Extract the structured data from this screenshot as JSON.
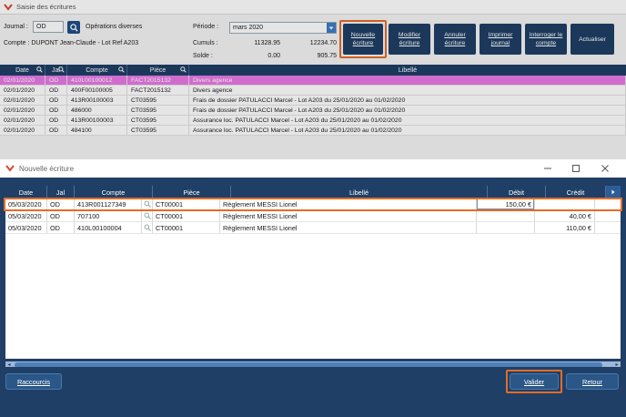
{
  "background_window": {
    "title": "Saisie des écritures",
    "journal_label": "Journal :",
    "journal_value": "OD",
    "journal_desc": "Opérations diverses",
    "periode_label": "Période :",
    "periode_value": "mars 2020",
    "compte_label": "Compte : DUPONT Jean-Claude - Lot Ref A203",
    "cumuls_label": "Cumuls :",
    "cumuls_debit": "11328.95",
    "cumuls_credit": "12234.70",
    "solde_label": "Solde :",
    "solde_debit": "0.00",
    "solde_credit": "905.75",
    "toolbar": {
      "nouvelle": "Nouvelle écriture",
      "modifier": "Modifier écriture",
      "annuler": "Annuler écriture",
      "imprimer": "Imprimer journal",
      "interroger": "Interroger le compte",
      "actualiser": "Actualiser"
    },
    "columns": [
      "Date",
      "Jal",
      "Compte",
      "Pièce",
      "Libellé"
    ],
    "rows": [
      [
        "02/01/2020",
        "OD",
        "410L00100012",
        "FACT2015132",
        "Divers agence"
      ],
      [
        "02/01/2020",
        "OD",
        "400F00100005",
        "FACT2015132",
        "Divers agence"
      ],
      [
        "02/01/2020",
        "OD",
        "413R00100003",
        "CT03595",
        "Frais de dossier PATULACCI Marcel - Lot A203  du 25/01/2020 au 01/02/2020"
      ],
      [
        "02/01/2020",
        "OD",
        "486000",
        "CT03595",
        "Frais de dossier PATULACCI Marcel - Lot A203  du 25/01/2020 au 01/02/2020"
      ],
      [
        "02/01/2020",
        "OD",
        "413R00100003",
        "CT03595",
        "Assurance loc. PATULACCI Marcel - Lot A203  du 25/01/2020 au 01/02/2020"
      ],
      [
        "02/01/2020",
        "OD",
        "484100",
        "CT03595",
        "Assurance loc. PATULACCI Marcel - Lot A203  du 25/01/2020 au 01/02/2020"
      ]
    ]
  },
  "dialog": {
    "title": "Nouvelle écriture",
    "columns": {
      "date": "Date",
      "jal": "Jal",
      "compte": "Compte",
      "piece": "Pièce",
      "libelle": "Libellé",
      "debit": "Débit",
      "credit": "Crédit"
    },
    "rows": [
      {
        "date": "05/03/2020",
        "jal": "OD",
        "compte": "413R001127349",
        "piece": "CT00001",
        "libelle": "Règlement MESSI Lionel",
        "debit": "150,00 €",
        "credit": ""
      },
      {
        "date": "05/03/2020",
        "jal": "OD",
        "compte": "707100",
        "piece": "CT00001",
        "libelle": "Règlement MESSI Lionel",
        "debit": "",
        "credit": "40,00 €"
      },
      {
        "date": "05/03/2020",
        "jal": "OD",
        "compte": "410L00100004",
        "piece": "CT00001",
        "libelle": "Règlement MESSI Lionel",
        "debit": "",
        "credit": "110,00 €"
      }
    ],
    "buttons": {
      "raccourcis": "Raccourcis",
      "valider": "Valider",
      "retour": "Retour"
    }
  },
  "colors": {
    "navy": "#1f3f66",
    "highlight_orange": "#e76b25",
    "selected_row": "#e879e6"
  }
}
